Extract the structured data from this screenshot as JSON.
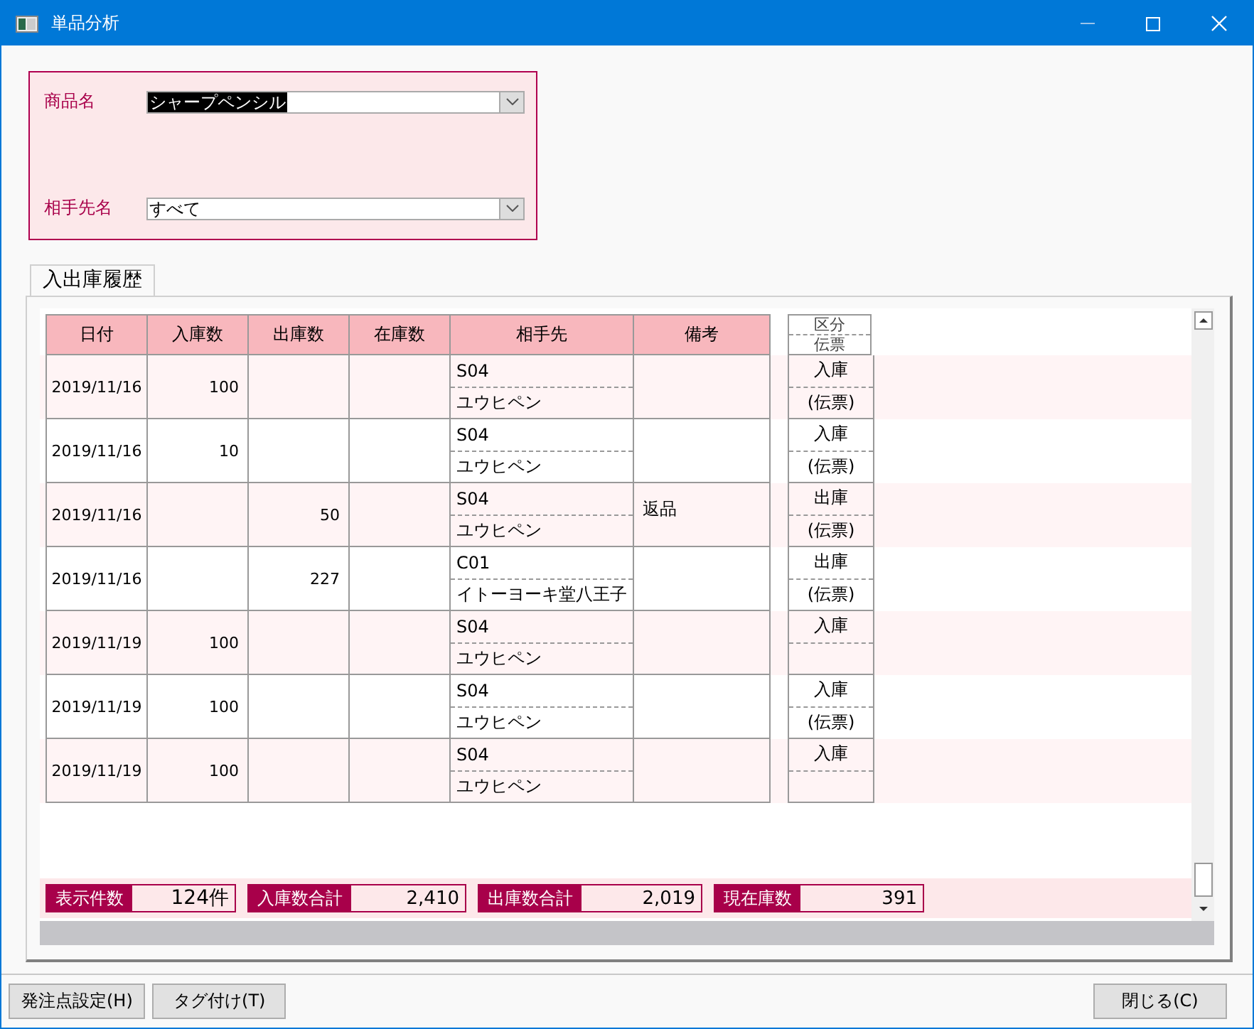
{
  "window": {
    "title": "単品分析"
  },
  "filters": [
    {
      "label": "商品名",
      "value": "シャープペンシル",
      "highlighted": true
    },
    {
      "label": "相手先名",
      "value": "すべて",
      "highlighted": false
    }
  ],
  "tabs": [
    {
      "label": "入出庫履歴",
      "selected": true
    }
  ],
  "table": {
    "columns": [
      "日付",
      "入庫数",
      "出庫数",
      "在庫数",
      "相手先",
      "備考"
    ],
    "side_header": [
      "区分",
      "伝票"
    ],
    "rows": [
      {
        "date": "2019/11/16",
        "in": "100",
        "partner_code": "S04",
        "partner_name": "ユウヒペン",
        "type": "入庫",
        "slip": "(伝票)"
      },
      {
        "date": "2019/11/16",
        "in": "10",
        "partner_code": "S04",
        "partner_name": "ユウヒペン",
        "type": "入庫",
        "slip": "(伝票)"
      },
      {
        "date": "2019/11/16",
        "out": "50",
        "partner_code": "S04",
        "partner_name": "ユウヒペン",
        "note": "返品",
        "type": "出庫",
        "slip": "(伝票)"
      },
      {
        "date": "2019/11/16",
        "out": "227",
        "partner_code": "C01",
        "partner_name": "イトーヨーキ堂八王子",
        "type": "出庫",
        "slip": "(伝票)"
      },
      {
        "date": "2019/11/19",
        "in": "100",
        "partner_code": "S04",
        "partner_name": "ユウヒペン",
        "type": "入庫"
      },
      {
        "date": "2019/11/19",
        "in": "100",
        "partner_code": "S04",
        "partner_name": "ユウヒペン",
        "type": "入庫",
        "slip": "(伝票)"
      },
      {
        "date": "2019/11/19",
        "in": "100",
        "partner_code": "S04",
        "partner_name": "ユウヒペン",
        "type": "入庫"
      }
    ]
  },
  "totals": [
    {
      "label": "表示件数",
      "value": "124件"
    },
    {
      "label": "入庫数合計",
      "value": "2,410"
    },
    {
      "label": "出庫数合計",
      "value": "2,019"
    },
    {
      "label": "現在庫数",
      "value": "391"
    }
  ],
  "buttons": [
    {
      "label": "発注点設定(H)"
    },
    {
      "label": "タグ付け(T)"
    },
    {
      "label": "閉じる(C)"
    }
  ]
}
